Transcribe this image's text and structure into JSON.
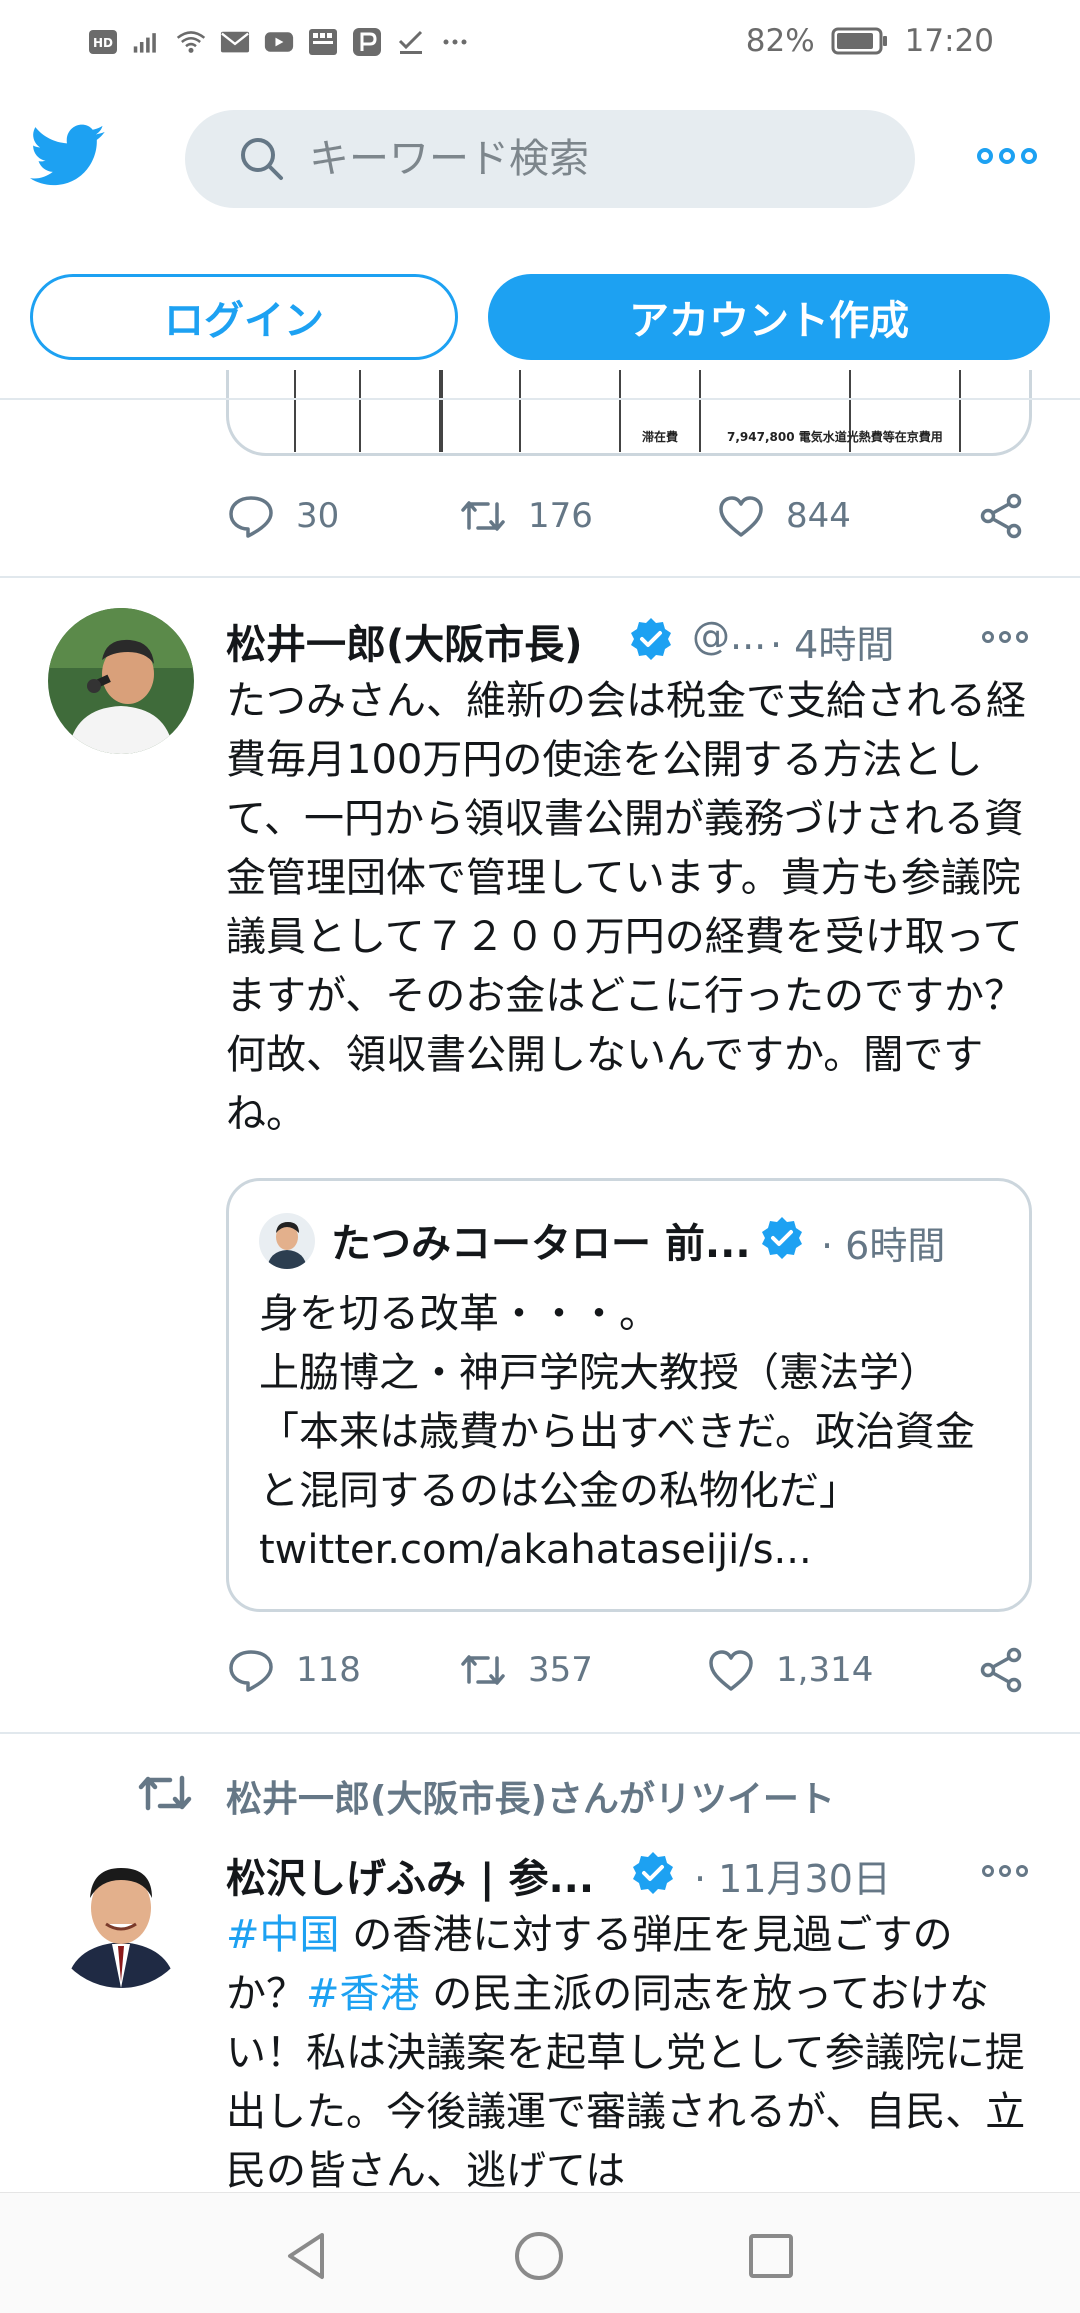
{
  "status_bar": {
    "battery": "82%",
    "time": "17:20",
    "left_icons": [
      "hd-icon",
      "signal-icon",
      "wifi-icon",
      "mail-icon",
      "youtube-icon",
      "app-icon",
      "paypay-icon",
      "check-icon",
      "more-notifications-icon"
    ]
  },
  "header": {
    "search_placeholder": "キーワード検索",
    "login_label": "ログイン",
    "signup_label": "アカウント作成"
  },
  "partial_image": {
    "cells": [
      "滞在費",
      "7,947,800 電気水道光熱費等在京費用"
    ]
  },
  "tweet0": {
    "replies": "30",
    "retweets": "176",
    "likes": "844"
  },
  "tweet1": {
    "name": "松井一郎(大阪市長)",
    "handle": "@...",
    "time": "· 4時間",
    "body": "たつみさん、維新の会は税金で支給される経費毎月100万円の使途を公開する方法として、一円から領収書公開が義務づけされる資金管理団体で管理しています。貴方も参議院議員として７２００万円の経費を受け取ってますが、そのお金はどこに行ったのですか？何故、領収書公開しないんですか。闇ですね。",
    "quote": {
      "name": "たつみコータロー 前...",
      "time": "· 6時間",
      "body": "身を切る改革・・・。\n上脇博之・神戸学院大教授（憲法学）「本来は歳費から出すべきだ。政治資金と混同するのは公金の私物化だ」 twitter.com/akahataseiji/s..."
    },
    "replies": "118",
    "retweets": "357",
    "likes": "1,314"
  },
  "retweet_label": "松井一郎(大阪市長)さんがリツイート",
  "tweet2": {
    "name": "松沢しげふみ | 参...",
    "time": "· 11月30日",
    "hashtag1": "#中国",
    "text1": " の香港に対する弾圧を見過ごすのか？",
    "hashtag2": "#香港",
    "text2": " の民主派の同志を放っておけない！私は決議案を起草し党として参議院に提出した。今後議運で審議されるが、自民、立民の皆さん、逃げては"
  },
  "colors": {
    "accent": "#1da1f2",
    "muted": "#657786",
    "text": "#14171a",
    "divider": "#e1e8ed"
  }
}
